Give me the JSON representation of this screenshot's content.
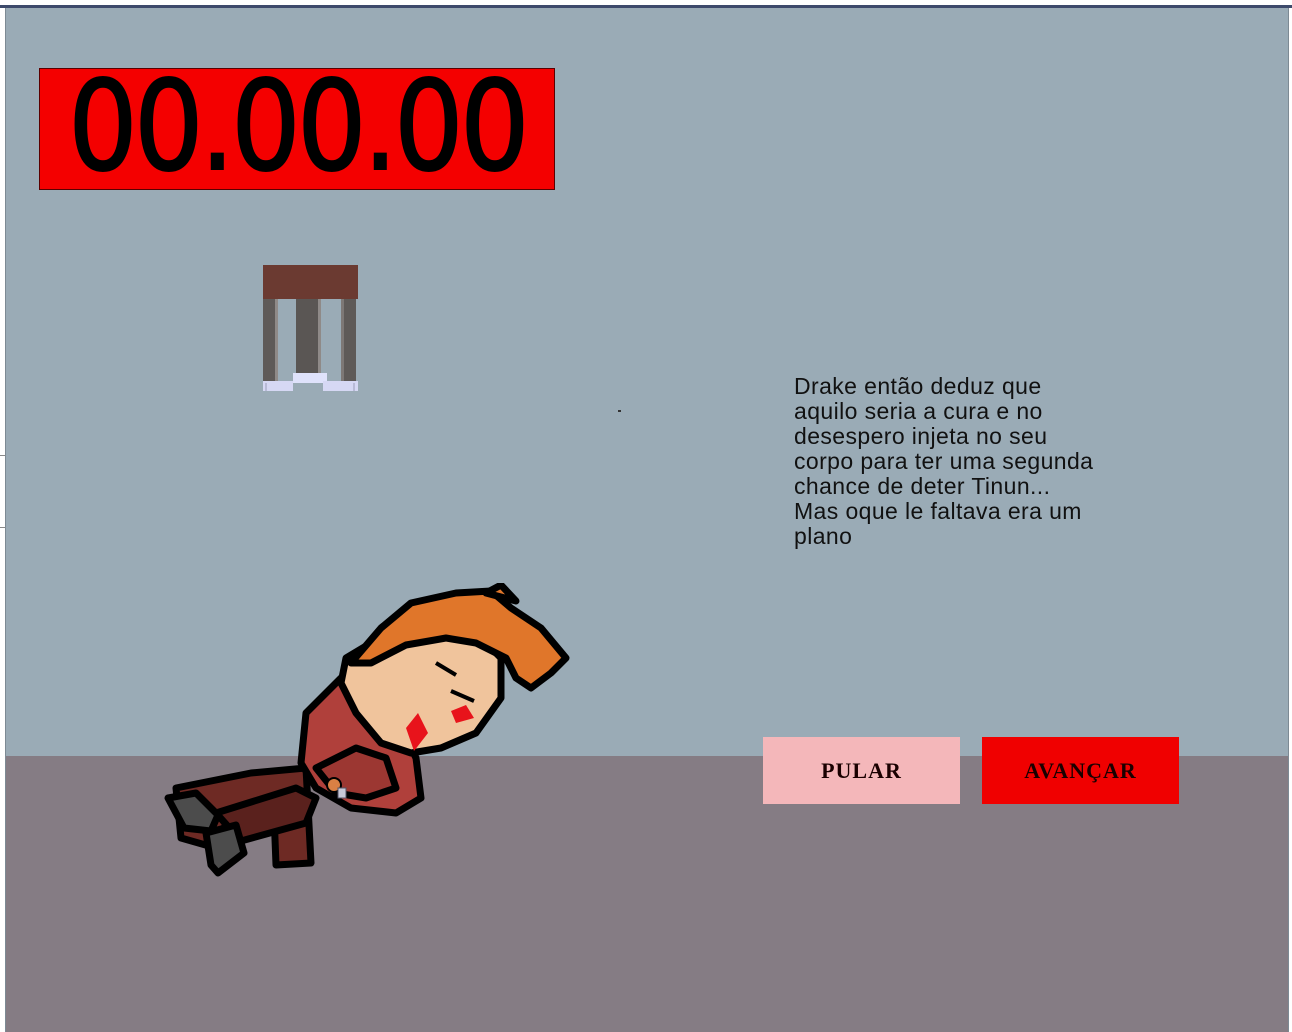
{
  "timer": {
    "display": "00.00.00"
  },
  "story": {
    "text": "Drake então deduz que\naquilo seria a cura e no\ndesespero injeta no seu\ncorpo para ter uma segunda\nchance de deter Tinun...\nMas oque le faltava era um\nplano"
  },
  "buttons": {
    "skip_label": "PULAR",
    "next_label": "AVANÇAR"
  },
  "colors": {
    "sky": "#9aabb6",
    "floor": "#857c84",
    "timer_bg": "#f40000",
    "skip_bg": "#f4b7ba",
    "next_bg": "#f00000"
  },
  "sprites": {
    "stool": "stool-sprite",
    "character": "drake-injured-sprite"
  }
}
